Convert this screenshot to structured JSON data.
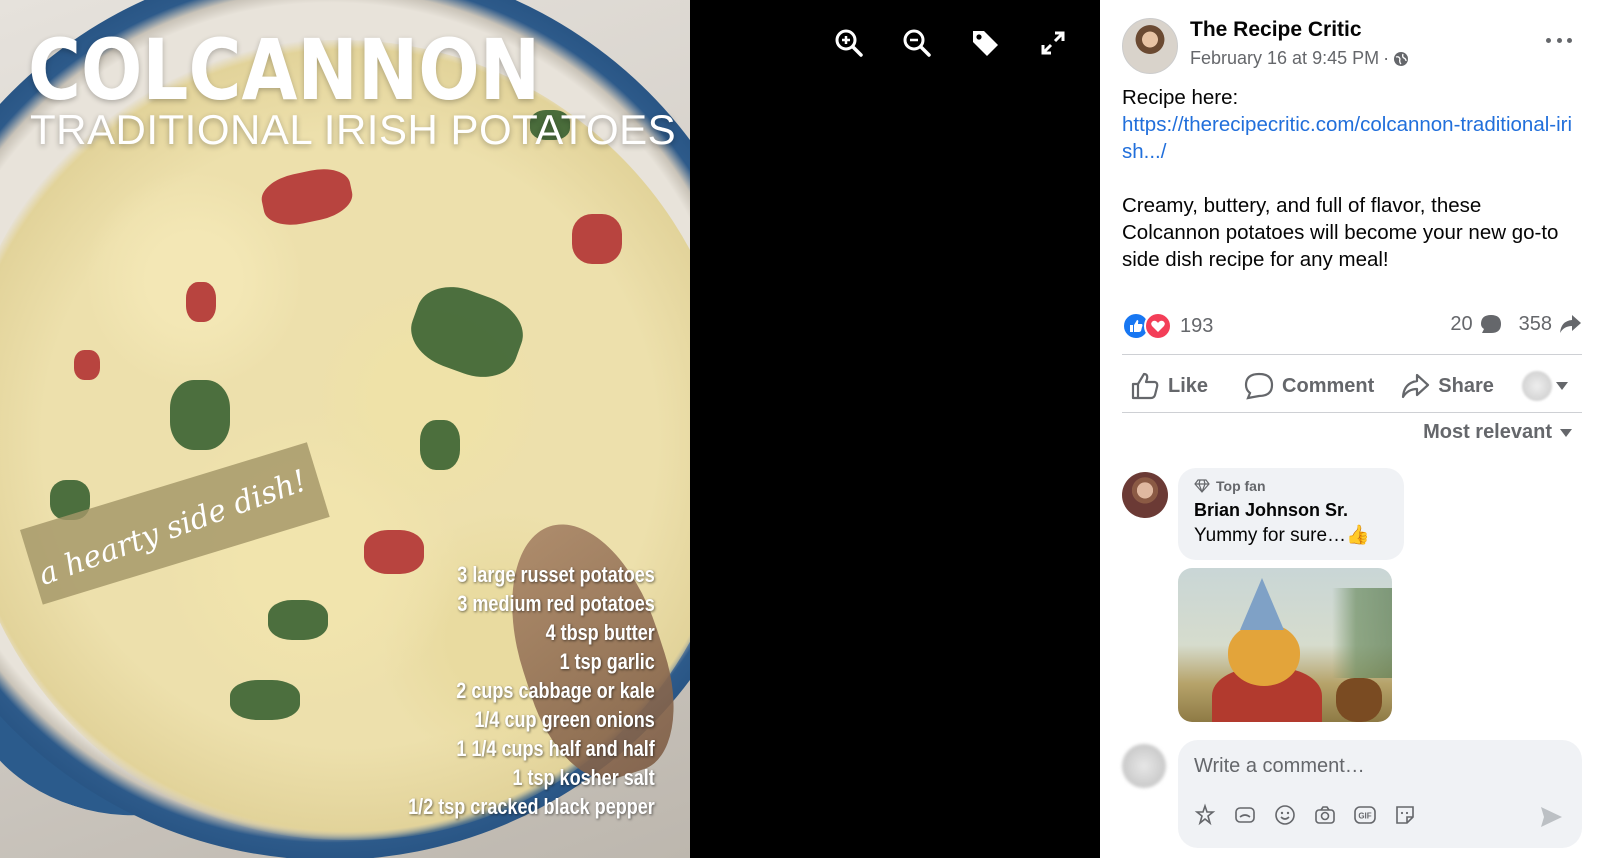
{
  "photo": {
    "title": "COLCANNON",
    "subtitle": "TRADITIONAL IRISH POTATOES",
    "banner": "a hearty side dish!",
    "ingredients": [
      "3 large russet potatoes",
      "3 medium red potatoes",
      "4 tbsp butter",
      "1 tsp garlic",
      "2 cups cabbage or kale",
      "1/4 cup green onions",
      "1 1/4 cups half and half",
      "1 tsp kosher salt",
      "1/2 tsp cracked black pepper"
    ]
  },
  "viewer_tools": [
    "zoom-in-icon",
    "zoom-out-icon",
    "tag-icon",
    "fullscreen-icon"
  ],
  "post": {
    "page_name": "The Recipe Critic",
    "timestamp": "February 16 at 9:45 PM",
    "meta_sep": "·",
    "text_intro": "Recipe here:",
    "link": "https://therecipecritic.com/colcannon-traditional-irish.../",
    "text_body": "Creamy, buttery, and full of flavor, these Colcannon potatoes will become your new go-to side dish recipe for any meal!"
  },
  "stats": {
    "reactions": "193",
    "comments": "20",
    "shares": "358"
  },
  "actions": {
    "like": "Like",
    "comment": "Comment",
    "share": "Share"
  },
  "sort": "Most relevant",
  "comment": {
    "badge": "Top fan",
    "author": "Brian Johnson Sr.",
    "text": "Yummy for sure…👍"
  },
  "composer": {
    "placeholder": "Write a comment…"
  },
  "colors": {
    "link": "#216fdb",
    "like_blue": "#1877f2",
    "love_red": "#f33e58",
    "secondary_text": "#65676b"
  }
}
